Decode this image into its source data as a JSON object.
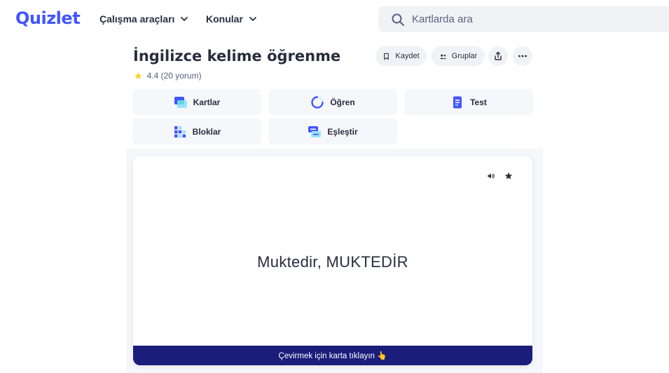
{
  "header": {
    "logo": "Quizlet",
    "nav": {
      "tools_label": "Çalışma araçları",
      "topics_label": "Konular"
    },
    "search": {
      "placeholder": "Kartlarda ara"
    }
  },
  "set": {
    "title": "İngilizce kelime öğrenme",
    "rating_text": "4.4 (20 yorum)",
    "actions": {
      "save_label": "Kaydet",
      "groups_label": "Gruplar"
    }
  },
  "modes": [
    {
      "label": "Kartlar",
      "icon": "cards-icon"
    },
    {
      "label": "Öğren",
      "icon": "learn-icon"
    },
    {
      "label": "Test",
      "icon": "test-icon"
    },
    {
      "label": "Bloklar",
      "icon": "blocks-icon"
    },
    {
      "label": "Eşleştir",
      "icon": "match-icon"
    }
  ],
  "flashcard": {
    "term": "Muktedir, MUKTEDİR",
    "flip_hint": "Çevirmek için karta tıklayın 👆"
  },
  "colors": {
    "brand": "#4255ff",
    "footer": "#1a1d7a",
    "star": "#ffcd1f"
  }
}
